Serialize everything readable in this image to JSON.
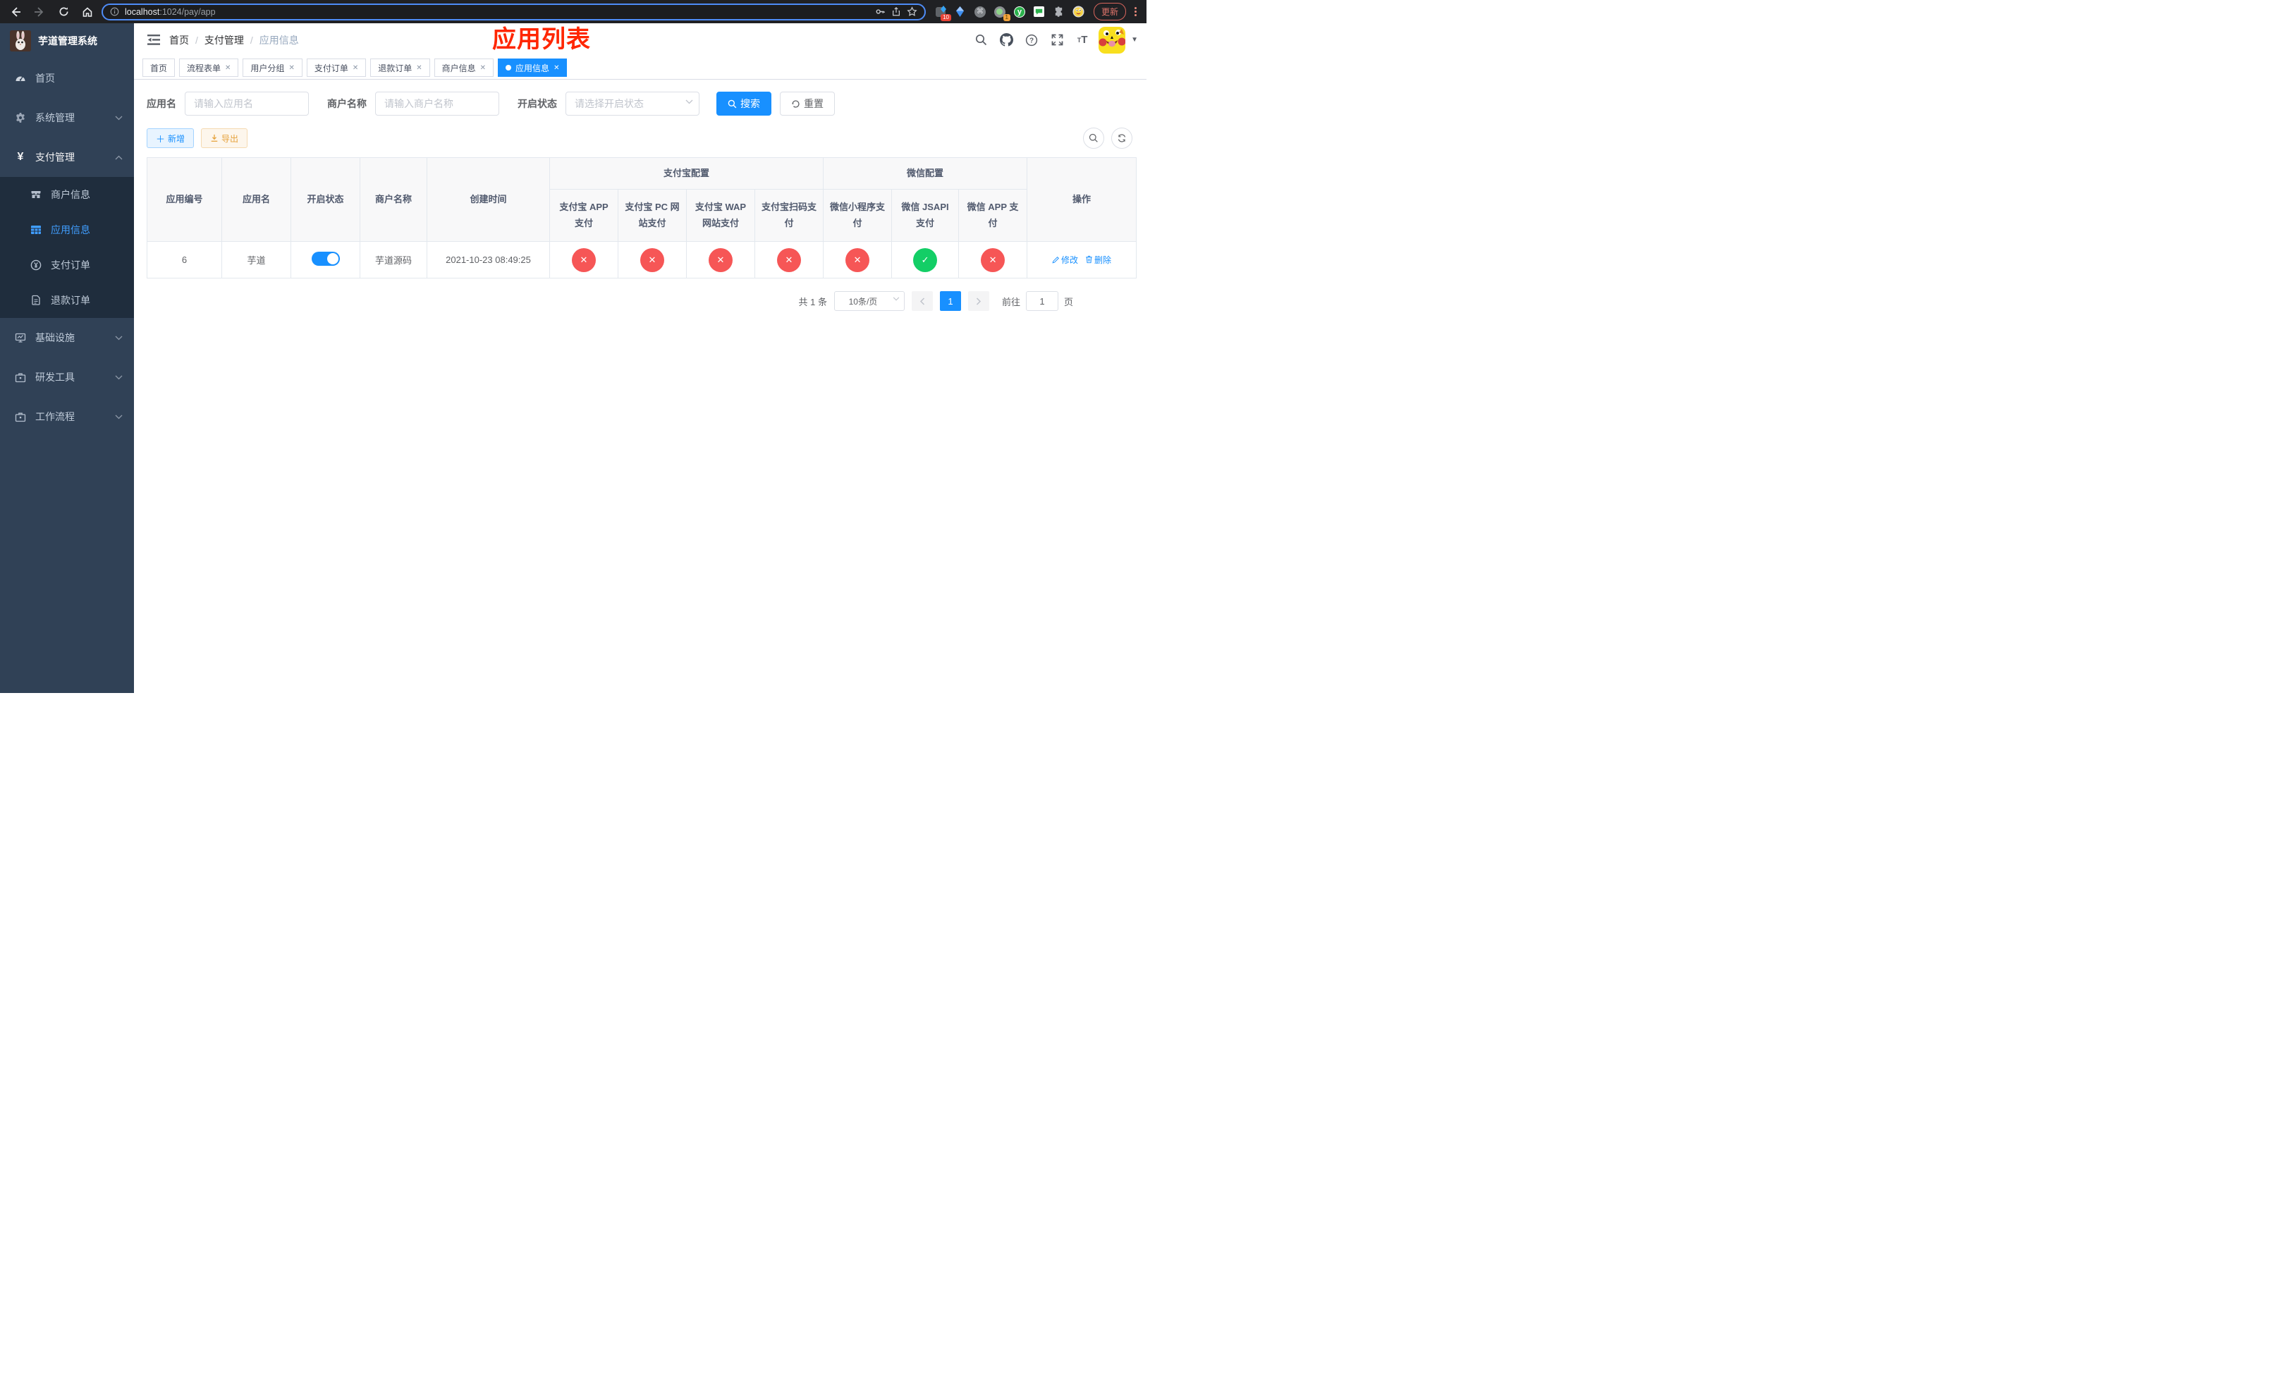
{
  "colors": {
    "accent": "#1890ff",
    "sidebar_active": "#409eff",
    "danger": "#f65656",
    "success": "#13ce66",
    "annotation": "#ff2600"
  },
  "browser": {
    "url": "localhost:1024/pay/app",
    "url_host": "localhost",
    "url_rest": ":1024/pay/app",
    "update_label": "更新",
    "ext_badge_pin": "10",
    "ext_badge_proxy": "1"
  },
  "sidebar": {
    "title": "芋道管理系统",
    "items": [
      {
        "label": "首页"
      },
      {
        "label": "系统管理"
      },
      {
        "label": "支付管理",
        "children": [
          {
            "label": "商户信息"
          },
          {
            "label": "应用信息"
          },
          {
            "label": "支付订单"
          },
          {
            "label": "退款订单"
          }
        ]
      },
      {
        "label": "基础设施"
      },
      {
        "label": "研发工具"
      },
      {
        "label": "工作流程"
      }
    ]
  },
  "header": {
    "breadcrumb": [
      "首页",
      "支付管理",
      "应用信息"
    ],
    "annotation": "应用列表"
  },
  "tabs": [
    {
      "label": "首页"
    },
    {
      "label": "流程表单"
    },
    {
      "label": "用户分组"
    },
    {
      "label": "支付订单"
    },
    {
      "label": "退款订单"
    },
    {
      "label": "商户信息"
    },
    {
      "label": "应用信息"
    }
  ],
  "filters": {
    "app_name_label": "应用名",
    "app_name_placeholder": "请输入应用名",
    "merchant_label": "商户名称",
    "merchant_placeholder": "请输入商户名称",
    "status_label": "开启状态",
    "status_placeholder": "请选择开启状态",
    "search_label": "搜索",
    "reset_label": "重置"
  },
  "toolbar": {
    "add_label": "新增",
    "export_label": "导出"
  },
  "table": {
    "columns": {
      "app_id": "应用编号",
      "app_name": "应用名",
      "status": "开启状态",
      "merchant": "商户名称",
      "create_time": "创建时间",
      "alipay_group": "支付宝配置",
      "wechat_group": "微信配置",
      "alipay_app": "支付宝 APP 支付",
      "alipay_pc": "支付宝 PC 网站支付",
      "alipay_wap": "支付宝 WAP 网站支付",
      "alipay_qr": "支付宝扫码支付",
      "wechat_lite": "微信小程序支付",
      "wechat_jsapi": "微信 JSAPI 支付",
      "wechat_app": "微信 APP 支付",
      "actions": "操作"
    },
    "row": {
      "id": "6",
      "name": "芋道",
      "status": "on",
      "merchant": "芋道源码",
      "created": "2021-10-23 08:49:25",
      "channels": [
        {
          "name": "alipay-app",
          "state": "off"
        },
        {
          "name": "alipay-pc",
          "state": "off"
        },
        {
          "name": "alipay-wap",
          "state": "off"
        },
        {
          "name": "alipay-qr",
          "state": "off"
        },
        {
          "name": "wechat-lite",
          "state": "off"
        },
        {
          "name": "wechat-jsapi",
          "state": "on"
        },
        {
          "name": "wechat-app",
          "state": "off"
        }
      ],
      "edit_label": "修改",
      "delete_label": "删除"
    }
  },
  "pagination": {
    "total": "共 1 条",
    "page_size": "10条/页",
    "page": "1",
    "goto_prefix": "前往",
    "goto_value": "1",
    "goto_suffix": "页"
  }
}
